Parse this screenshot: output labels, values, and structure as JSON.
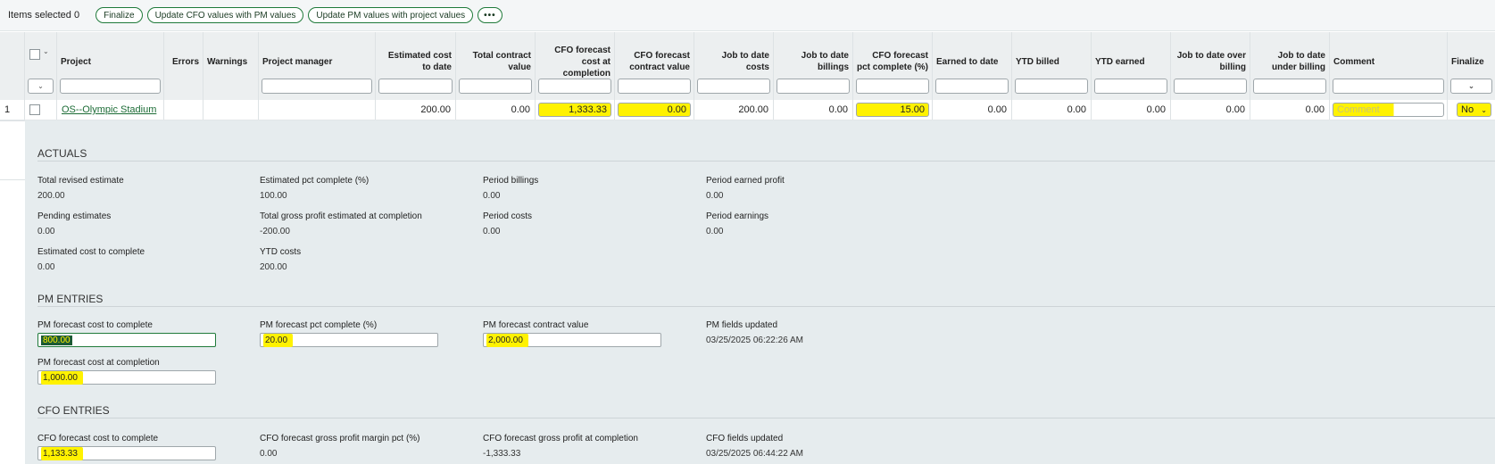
{
  "toolbar": {
    "items_selected": "Items selected 0",
    "finalize": "Finalize",
    "update_cfo": "Update CFO values with PM values",
    "update_pm": "Update PM values with project values",
    "more": "•••"
  },
  "columns": {
    "project": "Project",
    "errors": "Errors",
    "warnings": "Warnings",
    "project_manager": "Project manager",
    "est_cost": "Estimated cost to date",
    "total_contract": "Total contract value",
    "cfo_cost_completion": "CFO forecast cost at completion",
    "cfo_contract": "CFO forecast contract value",
    "jtd_costs": "Job to date costs",
    "jtd_billings": "Job to date billings",
    "cfo_pct": "CFO forecast pct complete (%)",
    "earned_to_date": "Earned to date",
    "ytd_billed": "YTD billed",
    "ytd_earned": "YTD earned",
    "jtd_over": "Job to date over billing",
    "jtd_under": "Job to date under billing",
    "comment": "Comment",
    "finalize": "Finalize"
  },
  "row": {
    "num": "1",
    "project": "OS--Olympic Stadium",
    "est_cost": "200.00",
    "total_contract": "0.00",
    "cfo_cost_completion": "1,333.33",
    "cfo_contract": "0.00",
    "jtd_costs": "200.00",
    "jtd_billings": "0.00",
    "cfo_pct": "15.00",
    "earned_to_date": "0.00",
    "ytd_billed": "0.00",
    "ytd_earned": "0.00",
    "jtd_over": "0.00",
    "jtd_under": "0.00",
    "comment_placeholder": "Comment",
    "finalize": "No"
  },
  "actuals": {
    "title": "ACTUALS",
    "total_revised_estimate_label": "Total revised estimate",
    "total_revised_estimate": "200.00",
    "est_pct_complete_label": "Estimated pct complete (%)",
    "est_pct_complete": "100.00",
    "period_billings_label": "Period billings",
    "period_billings": "0.00",
    "period_earned_profit_label": "Period earned profit",
    "period_earned_profit": "0.00",
    "pending_estimates_label": "Pending estimates",
    "pending_estimates": "0.00",
    "total_gross_profit_label": "Total gross profit estimated at completion",
    "total_gross_profit": "-200.00",
    "period_costs_label": "Period costs",
    "period_costs": "0.00",
    "period_earnings_label": "Period earnings",
    "period_earnings": "0.00",
    "est_cost_to_complete_label": "Estimated cost to complete",
    "est_cost_to_complete": "0.00",
    "ytd_costs_label": "YTD costs",
    "ytd_costs": "200.00"
  },
  "pm": {
    "title": "PM ENTRIES",
    "cost_to_complete_label": "PM forecast cost to complete",
    "cost_to_complete": "800.00",
    "pct_complete_label": "PM forecast pct complete (%)",
    "pct_complete": "20.00",
    "contract_value_label": "PM forecast contract value",
    "contract_value": "2,000.00",
    "fields_updated_label": "PM fields updated",
    "fields_updated": "03/25/2025 06:22:26 AM",
    "cost_at_completion_label": "PM forecast cost at completion",
    "cost_at_completion": "1,000.00"
  },
  "cfo": {
    "title": "CFO ENTRIES",
    "cost_to_complete_label": "CFO forecast cost to complete",
    "cost_to_complete": "1,133.33",
    "gpm_pct_label": "CFO forecast gross profit margin pct (%)",
    "gpm_pct": "0.00",
    "gross_profit_label": "CFO forecast gross profit at completion",
    "gross_profit": "-1,333.33",
    "fields_updated_label": "CFO fields updated",
    "fields_updated": "03/25/2025 06:44:22 AM"
  },
  "colors": {
    "highlight": "#fff200",
    "accent": "#1f7a3a",
    "link": "#1c6c36"
  }
}
